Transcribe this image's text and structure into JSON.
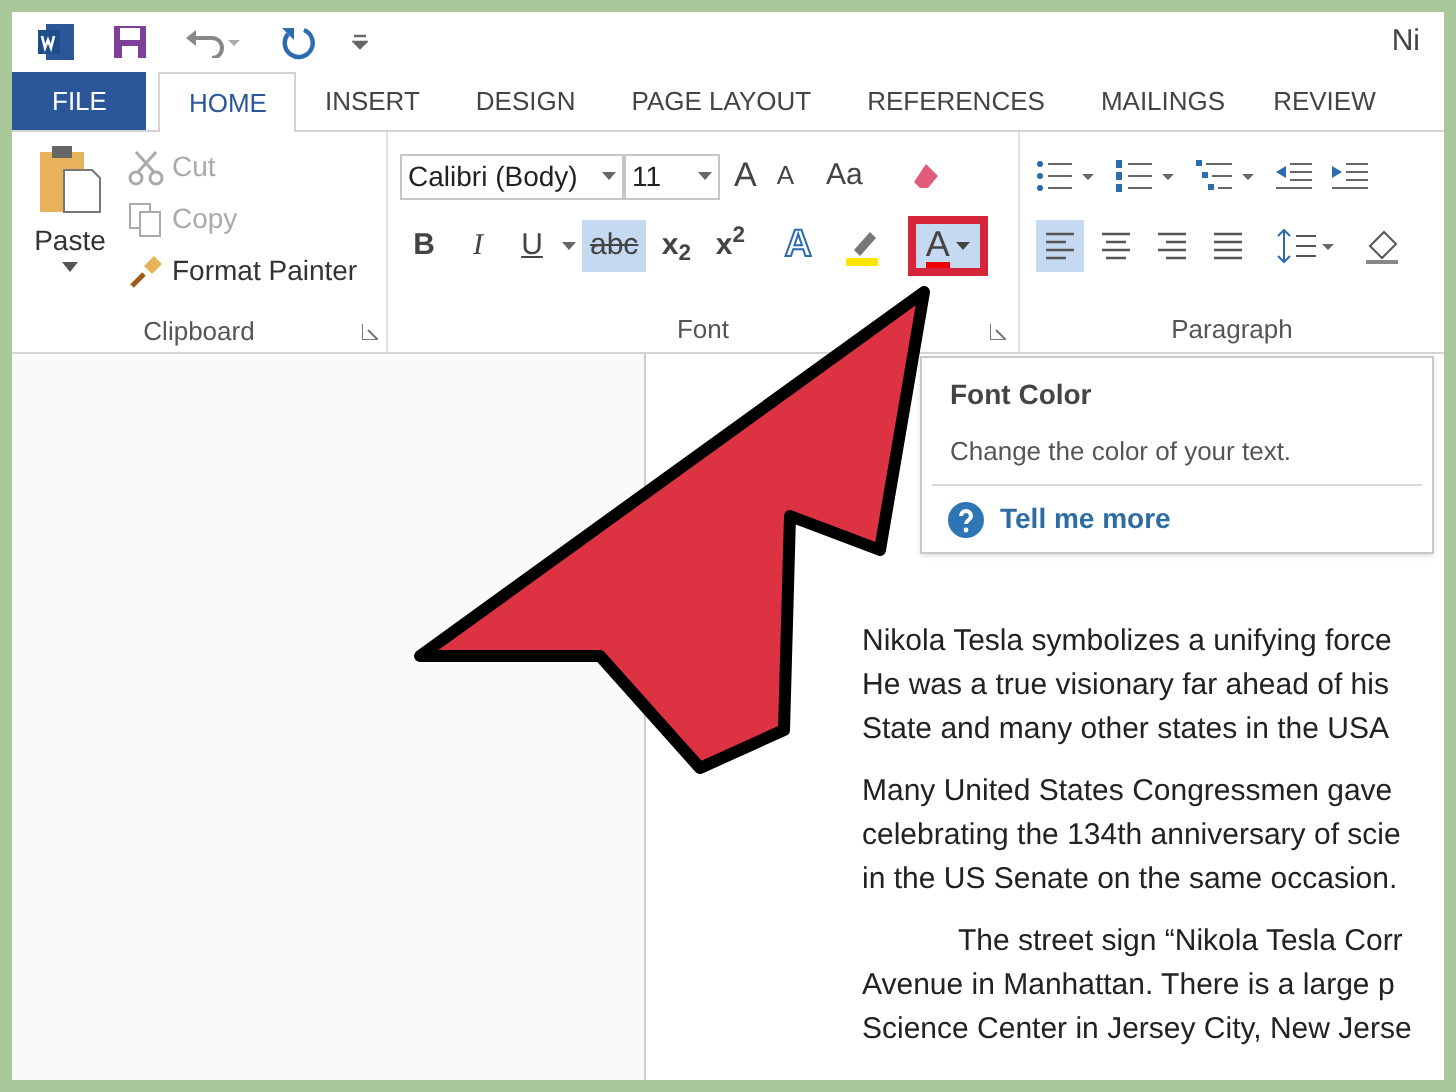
{
  "window": {
    "title": "Ni"
  },
  "tabs": [
    {
      "label": "FILE",
      "kind": "file",
      "selected": false
    },
    {
      "label": "HOME",
      "kind": "tab",
      "selected": true
    },
    {
      "label": "INSERT",
      "kind": "tab",
      "selected": false
    },
    {
      "label": "DESIGN",
      "kind": "tab",
      "selected": false
    },
    {
      "label": "PAGE LAYOUT",
      "kind": "tab",
      "selected": false
    },
    {
      "label": "REFERENCES",
      "kind": "tab",
      "selected": false
    },
    {
      "label": "MAILINGS",
      "kind": "tab",
      "selected": false
    },
    {
      "label": "REVIEW",
      "kind": "tab",
      "selected": false
    }
  ],
  "clipboard": {
    "paste": "Paste",
    "items": [
      {
        "label": "Cut",
        "disabled": true
      },
      {
        "label": "Copy",
        "disabled": true
      },
      {
        "label": "Format Painter",
        "disabled": false
      }
    ],
    "group_label": "Clipboard"
  },
  "font": {
    "font_name": "Calibri (Body)",
    "font_size": "11",
    "grow": "A",
    "shrink": "A",
    "change_case": "Aa",
    "format_buttons": [
      {
        "label": "B",
        "selected": false
      },
      {
        "label": "I",
        "selected": false
      },
      {
        "label": "U",
        "selected": false
      },
      {
        "label": "abc",
        "selected": true
      },
      {
        "label": "x$_{2}$",
        "selected": false
      },
      {
        "label": "x$^{2}$",
        "selected": false
      }
    ],
    "effects": "A",
    "font_color": {
      "label": "A",
      "selected": true
    },
    "group_label": "Font"
  },
  "paragraph": {
    "align_buttons": [
      {
        "selected": true
      },
      {
        "selected": false
      },
      {
        "selected": false
      },
      {
        "selected": false
      }
    ],
    "group_label": "Paragraph"
  },
  "tooltip": {
    "title": "Font Color",
    "description": "Change the color of your text.",
    "link": "Tell me more"
  },
  "document": {
    "paragraphs": [
      {
        "indented": false,
        "lines": [
          "Nikola Tesla symbolizes a unifying force",
          "He was a true visionary far ahead of his",
          "State and many other states in the USA"
        ]
      },
      {
        "indented": false,
        "lines": [
          "Many United States Congressmen gave",
          "celebrating the 134th anniversary of scie",
          "in the US Senate on the same occasion."
        ]
      },
      {
        "indented": true,
        "lines": [
          "The street sign “Nikola Tesla Corr",
          "Avenue in Manhattan. There is a large p",
          "Science Center in Jersey City, New Jerse"
        ]
      }
    ]
  }
}
